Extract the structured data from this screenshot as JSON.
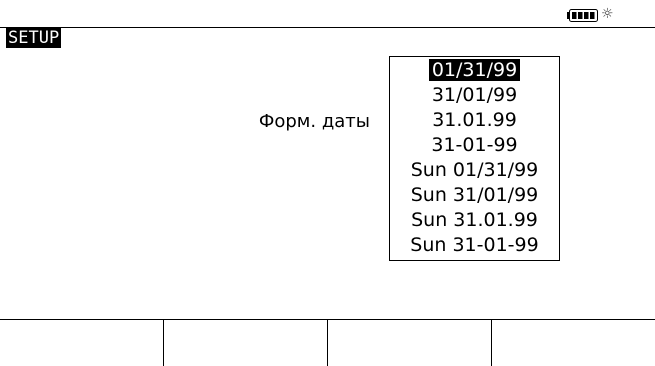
{
  "status_bar": {
    "battery_icon": "battery-full-icon",
    "backlight_icon": "backlight-icon",
    "backlight_glyph": "☼"
  },
  "screen": {
    "title": "SETUP",
    "field_label": "Форм. даты"
  },
  "date_format": {
    "selected_index": 0,
    "options": [
      "01/31/99",
      "31/01/99",
      "31.01.99",
      "31-01-99",
      "Sun 01/31/99",
      "Sun 31/01/99",
      "Sun 31.01.99",
      "Sun 31-01-99"
    ]
  },
  "softkeys": [
    "",
    "",
    "",
    ""
  ],
  "colors": {
    "foreground": "#000000",
    "background": "#ffffff"
  }
}
